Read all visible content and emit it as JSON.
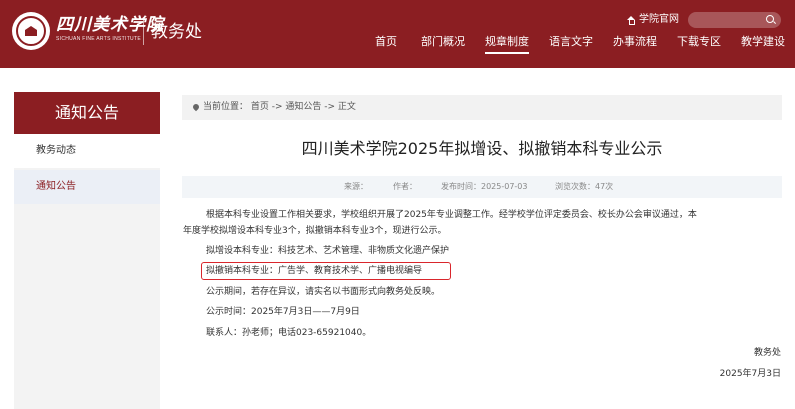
{
  "header": {
    "logo_cn": "四川美术学院",
    "logo_en": "SICHUAN FINE ARTS INSTITUTE",
    "dept": "教务处",
    "homepage_link": "学院官网",
    "nav": [
      "首页",
      "部门概况",
      "规章制度",
      "语言文字",
      "办事流程",
      "下载专区",
      "教学建设"
    ],
    "active_nav": "规章制度"
  },
  "sidebar": {
    "title": "通知公告",
    "items": [
      {
        "label": "教务动态",
        "active": false
      },
      {
        "label": "通知公告",
        "active": true
      }
    ]
  },
  "breadcrumb": {
    "text": "当前位置： 首页 -> 通知公告 -> 正文"
  },
  "article": {
    "title": "四川美术学院2025年拟增设、拟撤销本科专业公示",
    "meta": {
      "source": "来源：",
      "author": "作者：",
      "date": "发布时间：2025-07-03",
      "views": "浏览次数：47次"
    },
    "para1_line1": "根据本科专业设置工作相关要求，学校组织开展了2025年专业调整工作。经学校学位评定委员会、校长办公会审议通过，本",
    "para1_line2": "年度学校拟增设本科专业3个，拟撤销本科专业3个，现进行公示。",
    "add_majors": "拟增设本科专业：科技艺术、艺术管理、非物质文化遗产保护",
    "remove_majors": "拟撤销本科专业：广告学、教育技术学、广播电视编导",
    "objection": "公示期间，若存在异议，请实名以书面形式向教务处反映。",
    "period": "公示时间：2025年7月3日——7月9日",
    "contact": "联系人：孙老师；电话023-65921040。",
    "signature": "教务处",
    "sign_date": "2025年7月3日"
  },
  "colors": {
    "brand": "#8b1e22",
    "highlight_border": "#d9262c"
  }
}
